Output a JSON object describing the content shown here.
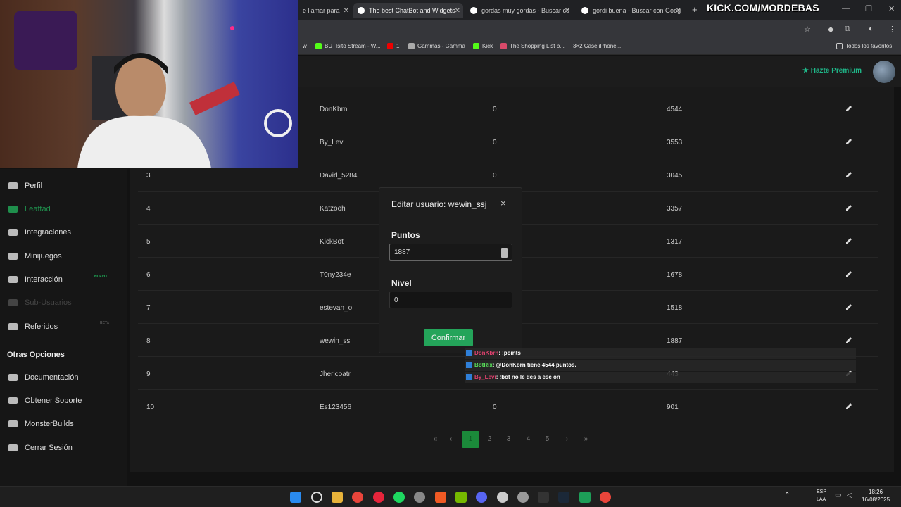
{
  "browser": {
    "tabs": [
      {
        "label": "e llamar para",
        "active": false
      },
      {
        "label": "The best ChatBot and Widgets",
        "active": true
      },
      {
        "label": "gordas muy gordas - Buscar co",
        "active": false
      },
      {
        "label": "gordi buena - Buscar con Goog",
        "active": false
      }
    ],
    "bookmarks": [
      "w",
      "BUTIsito Stream - W...",
      "1",
      "Gammas - Gamma",
      "Kick",
      "The Shopping List b...",
      "3×2 Case iPhone..."
    ],
    "all_bookmarks_label": "Todos los favoritos"
  },
  "stream_overlay": {
    "kick_url": "KICK.COM/MORDEBAS"
  },
  "header": {
    "premium_label": "Hazte Premium"
  },
  "sidebar": {
    "items": [
      {
        "label": "Perfil"
      },
      {
        "label": "Leaftad"
      },
      {
        "label": "Integraciones"
      },
      {
        "label": "Minijuegos"
      },
      {
        "label": "Interacción",
        "badge": "NUEVO"
      },
      {
        "label": "Sub-Usuarios"
      },
      {
        "label": "Referidos",
        "badge": "BETA"
      }
    ],
    "section_title": "Otras Opciones",
    "other_items": [
      {
        "label": "Documentación"
      },
      {
        "label": "Obtener Soporte"
      },
      {
        "label": "MonsterBuilds"
      },
      {
        "label": "Cerrar Sesión"
      }
    ]
  },
  "table": {
    "rows": [
      {
        "rank": "",
        "user": "DonKbrn",
        "level": "0",
        "points": "4544"
      },
      {
        "rank": "",
        "user": "By_Levi",
        "level": "0",
        "points": "3553"
      },
      {
        "rank": "3",
        "user": "David_5284",
        "level": "0",
        "points": "3045"
      },
      {
        "rank": "4",
        "user": "Katzooh",
        "level": "",
        "points": "3357"
      },
      {
        "rank": "5",
        "user": "KickBot",
        "level": "",
        "points": "1317"
      },
      {
        "rank": "6",
        "user": "T0ny234e",
        "level": "",
        "points": "1678"
      },
      {
        "rank": "7",
        "user": "estevan_o",
        "level": "",
        "points": "1518"
      },
      {
        "rank": "8",
        "user": "wewin_ssj",
        "level": "",
        "points": "1887"
      },
      {
        "rank": "9",
        "user": "Jhericoatr",
        "level": "",
        "points": "443"
      },
      {
        "rank": "10",
        "user": "Es123456",
        "level": "0",
        "points": "901"
      }
    ]
  },
  "pagination": {
    "first": "«",
    "prev": "‹",
    "pages": [
      "1",
      "2",
      "3",
      "4",
      "5"
    ],
    "current": "1",
    "next": "›",
    "last": "»"
  },
  "modal": {
    "title": "Editar usuario: wewin_ssj",
    "close": "×",
    "points_label": "Puntos",
    "points_value": "1887",
    "level_label": "Nivel",
    "level_value": "0",
    "confirm_label": "Confirmar"
  },
  "chat": [
    {
      "user": "DonKbrn",
      "message": ": !points",
      "color": "#e0416e"
    },
    {
      "user": "BotRix",
      "message": ": @DonKbrn tiene 4544 puntos.",
      "color": "#58e05a"
    },
    {
      "user": "By_Levi",
      "message": ": !bot no le des a ese on",
      "color": "#e0416e"
    }
  ],
  "taskbar": {
    "lang_1": "ESP",
    "lang_2": "LAA",
    "time": "18:26",
    "date": "16/08/2025"
  },
  "colors": {
    "accent_green": "#24a45a",
    "premium_teal": "#1fb98a"
  }
}
